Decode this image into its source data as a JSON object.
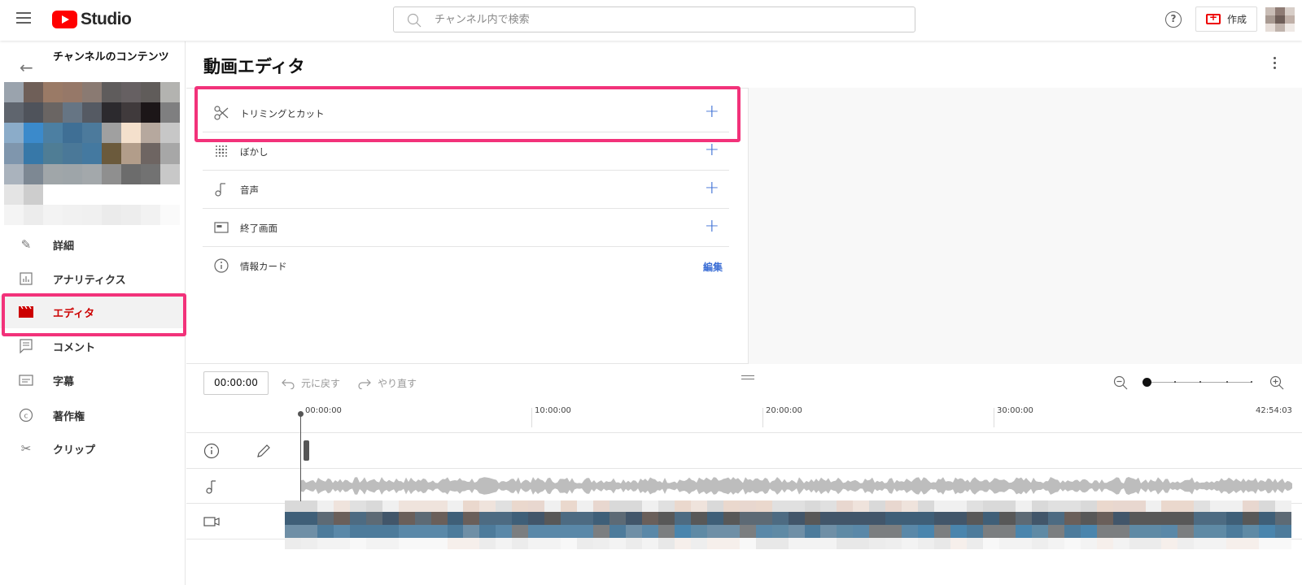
{
  "header": {
    "logo_text": "Studio",
    "search_placeholder": "チャンネル内で検索",
    "help_label": "?",
    "create_label": "作成"
  },
  "sidebar": {
    "channel_title": "チャンネルのコンテンツ",
    "items": [
      {
        "label": "詳細",
        "icon": "pencil-icon"
      },
      {
        "label": "アナリティクス",
        "icon": "analytics-icon"
      },
      {
        "label": "エディタ",
        "icon": "clapperboard-icon",
        "active": true
      },
      {
        "label": "コメント",
        "icon": "comment-icon"
      },
      {
        "label": "字幕",
        "icon": "subtitles-icon"
      },
      {
        "label": "著作権",
        "icon": "copyright-icon"
      },
      {
        "label": "クリップ",
        "icon": "scissors-icon"
      }
    ]
  },
  "main": {
    "title": "動画エディタ",
    "tools": [
      {
        "label": "トリミングとカット",
        "icon": "scissors-icon",
        "action": "+"
      },
      {
        "label": "ぼかし",
        "icon": "blur-icon",
        "action": "+"
      },
      {
        "label": "音声",
        "icon": "music-note-icon",
        "action": "+"
      },
      {
        "label": "終了画面",
        "icon": "end-screen-icon",
        "action": "+"
      },
      {
        "label": "情報カード",
        "icon": "info-icon",
        "action": "編集"
      }
    ]
  },
  "timeline": {
    "current_time": "00:00:00",
    "undo_label": "元に戻す",
    "redo_label": "やり直す",
    "ticks": [
      "00:00:00",
      "10:00:00",
      "20:00:00",
      "30:00:00",
      "42:54:03"
    ],
    "zoom_level": 0
  },
  "colors": {
    "accent_red": "#cc0000",
    "link_blue": "#3b6ed5",
    "highlight_pink": "#f2327a"
  }
}
